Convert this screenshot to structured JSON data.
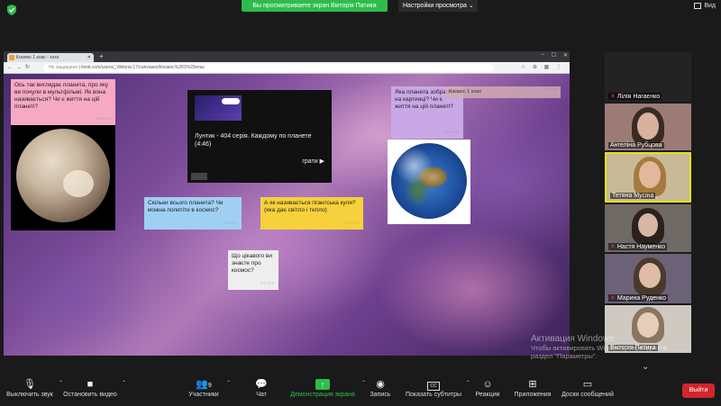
{
  "zoom": {
    "share_banner": "Вы просматриваете экран Вікторія Патика",
    "view_settings": "Настройки просмотра",
    "view_mode": "Вид",
    "toolbar": {
      "mute": "Выключить звук",
      "video": "Остановить видео",
      "participants": "Участники",
      "participants_count": "9",
      "chat": "Чат",
      "share": "Демонстрация экрана",
      "record": "Запись",
      "captions": "Показать субтитры",
      "reactions": "Реакции",
      "apps": "Приложения",
      "whiteboard": "Доски сообщений",
      "leave": "Выйти"
    },
    "participants": [
      {
        "name": "Лілія Нагаєнко"
      },
      {
        "name": "Ангеліна Рубцова"
      },
      {
        "name": "Тетяна Мусіна"
      },
      {
        "name": "Настя Науменко"
      },
      {
        "name": "Марина Руденко"
      },
      {
        "name": "Вікторія Патика"
      }
    ],
    "watermark": {
      "title": "Активация Windows",
      "line1": "Чтобы активировать Windows, перейдите в",
      "line2": "раздел \"Параметры\"."
    }
  },
  "browser": {
    "tab_title": "Космос 1 клас - xxxx",
    "not_secure": "Не защищено",
    "url": "linoit.com/users/_Viktoria-17/canvases/Космос%201%20клас"
  },
  "canvas": {
    "pink_note": "Ось так виглядає планета, про яку ви почули в мультфільмі. Як вона називається? Чи є життя на цій планеті?",
    "video_note": "Лунтик - 404 серія. Каждому по планете (4:46)",
    "video_play": "грати ▶",
    "lilac_note": "Яка планета зображена на картинці? Чи є життя на цій планеті?",
    "class_chip": "Космос 1 клас",
    "blue_note": "Скільки всього планета? Чи можна полетіти в космос?",
    "yellow_note": "А як називається гігантська куля? (яка дає світло і тепло)",
    "white_note": "Що цікавого ви знаєте про космос?"
  }
}
